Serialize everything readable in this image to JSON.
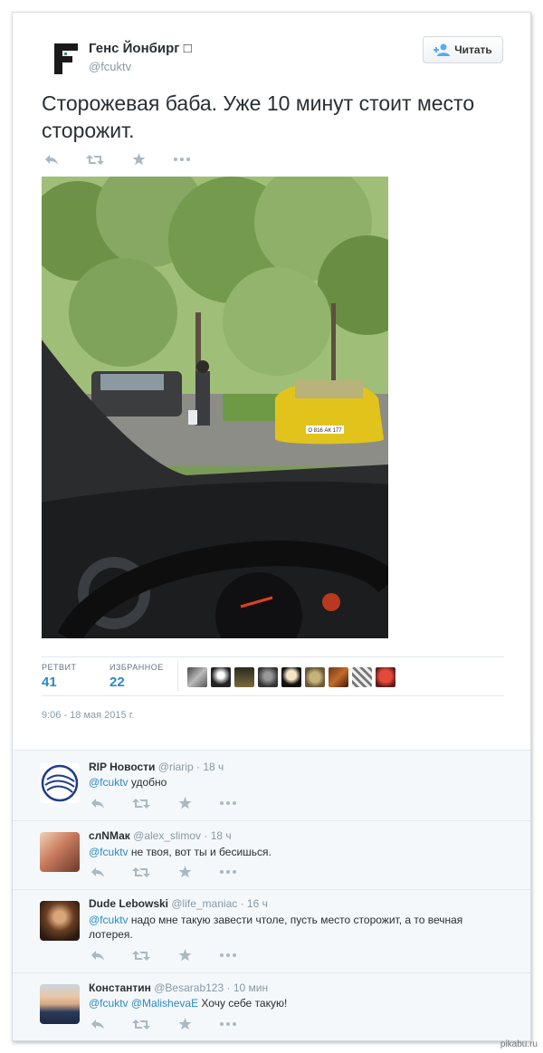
{
  "author": {
    "name": "Генс Йонбирг □",
    "handle": "@fcuktv"
  },
  "follow_button": {
    "label": "Читать",
    "icon": "add-user-icon"
  },
  "tweet": {
    "text": "Сторожевая баба. Уже 10 минут стоит место сторожит.",
    "stats": {
      "retweets_label": "РЕТВИТ",
      "retweets": "41",
      "favorites_label": "ИЗБРАННОЕ",
      "favorites": "22"
    },
    "timestamp": "9:06 - 18 мая 2015 г.",
    "photo": {
      "plate": "О 816 АК 177"
    }
  },
  "action_icons": [
    "reply-icon",
    "retweet-icon",
    "favorite-icon",
    "more-icon"
  ],
  "replies": [
    {
      "name": "RIP Новости",
      "handle": "@riarip",
      "time": "· 18 ч",
      "mention": "@fcuktv",
      "text": " удобно"
    },
    {
      "name": "слNМак",
      "handle": "@alex_slimov",
      "time": "· 18 ч",
      "mention": "@fcuktv",
      "text": " не твоя, вот ты и бесишься."
    },
    {
      "name": "Dude Lebowski",
      "handle": "@life_maniac",
      "time": "· 16 ч",
      "mention": "@fcuktv",
      "text": " надо мне такую завести чтоле, пусть место сторожит, а то вечная лотерея."
    },
    {
      "name": "Константин",
      "handle": "@Besarab123",
      "time": "· 10 мин",
      "mention": "@fcuktv @MalishevaE",
      "text": " Хочу себе такую!"
    }
  ],
  "watermark": "pikabu.ru",
  "colors": {
    "link": "#2a89c8",
    "muted": "#8899a6",
    "reply_bg": "#f5f8fa"
  }
}
